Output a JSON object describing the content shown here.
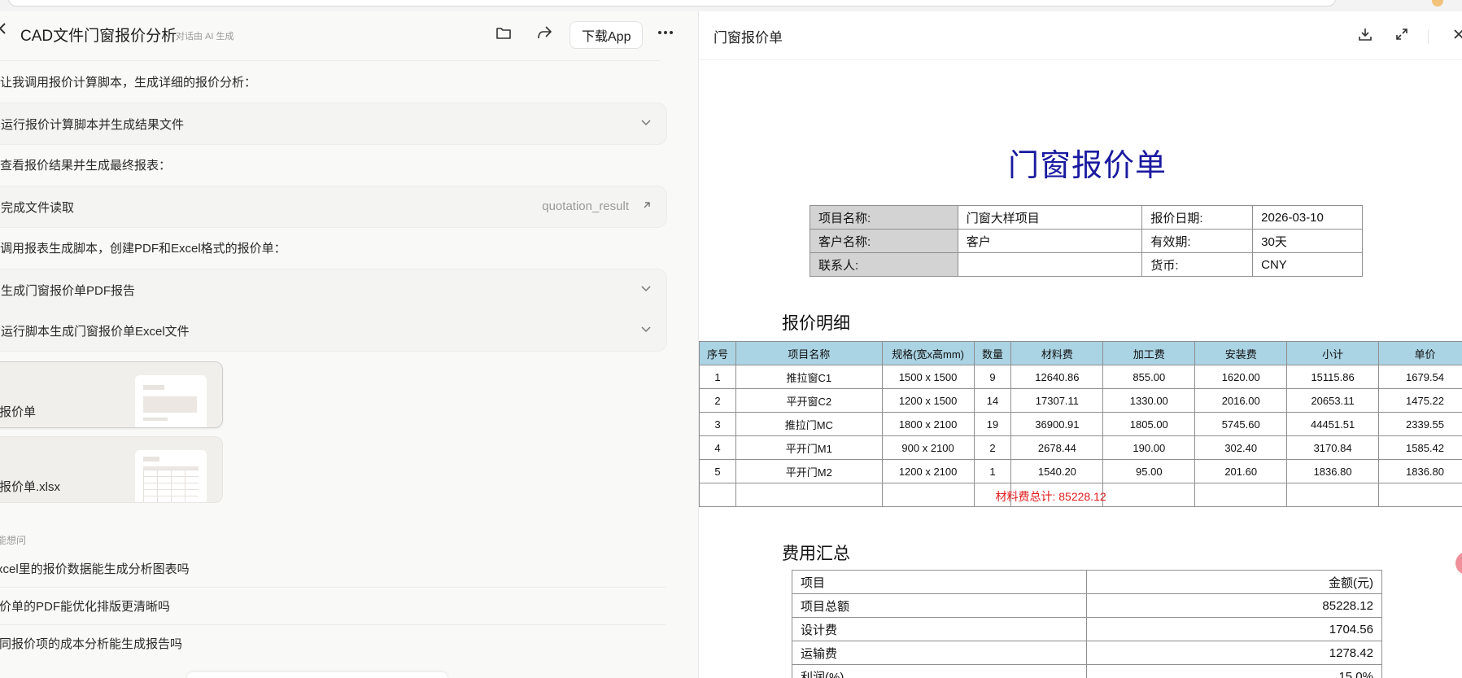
{
  "conversation": {
    "title": "CAD文件门窗报价分析",
    "ai_tag": "对话由 AI 生成",
    "download_app_label": "下载App",
    "messages": [
      "让我调用报价计算脚本，生成详细的报价分析：",
      "查看报价结果并生成最终报表：",
      "调用报表生成脚本，创建PDF和Excel格式的报价单："
    ],
    "step_card_1": {
      "label": "运行报价计算脚本并生成结果文件"
    },
    "step_card_2": {
      "label": "完成文件读取",
      "file_ref": "quotation_result"
    },
    "step_card_3": [
      {
        "label": "生成门窗报价单PDF报告"
      },
      {
        "label": "运行脚本生成门窗报价单Excel文件"
      }
    ],
    "files": [
      {
        "name": "门窗报价单"
      },
      {
        "name": "门窗报价单.xlsx"
      }
    ],
    "suggestions_label": "你可能想问",
    "suggestions": [
      "Excel里的报价数据能生成分析图表吗",
      "报价单的PDF能优化排版更清晰吗",
      "不同报价项的成本分析能生成报告吗"
    ]
  },
  "preview": {
    "panel_title": "门窗报价单",
    "doc_title": "门窗报价单",
    "info": {
      "project_name_label": "项目名称:",
      "project_name": "门窗大样项目",
      "date_label": "报价日期:",
      "date": "2026-03-10",
      "client_label": "客户名称:",
      "client": "客户",
      "validity_label": "有效期:",
      "validity": "30天",
      "contact_label": "联系人:",
      "contact": "",
      "currency_label": "货币:",
      "currency": "CNY"
    },
    "detail_title": "报价明细",
    "detail_headers": [
      "序号",
      "项目名称",
      "规格(宽x高mm)",
      "数量",
      "材料费",
      "加工费",
      "安装费",
      "小计",
      "单价"
    ],
    "detail_rows": [
      [
        "1",
        "推拉窗C1",
        "1500 x 1500",
        "9",
        "12640.86",
        "855.00",
        "1620.00",
        "15115.86",
        "1679.54"
      ],
      [
        "2",
        "平开窗C2",
        "1200 x 1500",
        "14",
        "17307.11",
        "1330.00",
        "2016.00",
        "20653.11",
        "1475.22"
      ],
      [
        "3",
        "推拉门MC",
        "1800 x 2100",
        "19",
        "36900.91",
        "1805.00",
        "5745.60",
        "44451.51",
        "2339.55"
      ],
      [
        "4",
        "平开门M1",
        "900 x 2100",
        "2",
        "2678.44",
        "190.00",
        "302.40",
        "3170.84",
        "1585.42"
      ],
      [
        "5",
        "平开门M2",
        "1200 x 2100",
        "1",
        "1540.20",
        "95.00",
        "201.60",
        "1836.80",
        "1836.80"
      ]
    ],
    "material_total": "材料费总计: 85228.12",
    "summary_title": "费用汇总",
    "summary_headers": [
      "项目",
      "金额(元)"
    ],
    "summary_rows": [
      [
        "项目总额",
        "85228.12"
      ],
      [
        "设计费",
        "1704.56"
      ],
      [
        "运输费",
        "1278.42"
      ],
      [
        "利润(%)",
        "15.0%"
      ]
    ]
  }
}
